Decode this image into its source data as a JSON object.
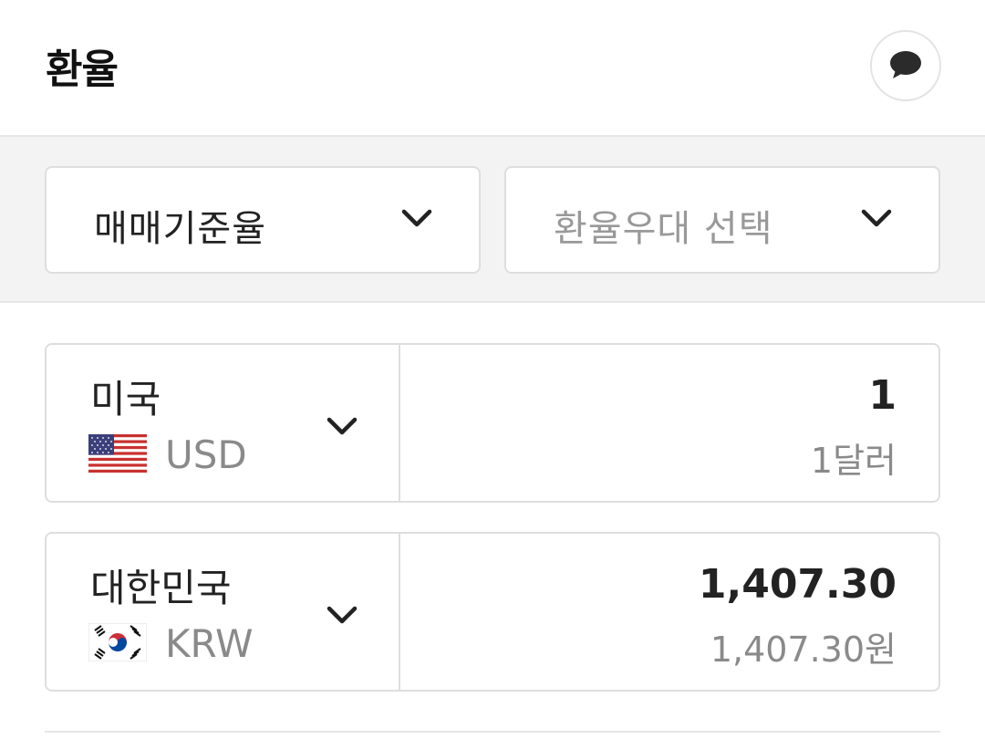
{
  "header": {
    "title": "환율",
    "chat_icon": "speech-bubble-icon"
  },
  "filters": {
    "rate_type": {
      "value": "매매기준율",
      "icon": "chevron-down-icon"
    },
    "preferential": {
      "placeholder": "환율우대 선택",
      "icon": "chevron-down-icon"
    }
  },
  "currencies": [
    {
      "country": "미국",
      "code": "USD",
      "flag": "us-flag-icon",
      "amount": "1",
      "amount_text": "1달러"
    },
    {
      "country": "대한민국",
      "code": "KRW",
      "flag": "kr-flag-icon",
      "amount": "1,407.30",
      "amount_text": "1,407.30원"
    }
  ],
  "colors": {
    "panel_bg": "#f3f3f3",
    "border": "#dedede",
    "muted_text": "#8a8a8a"
  }
}
